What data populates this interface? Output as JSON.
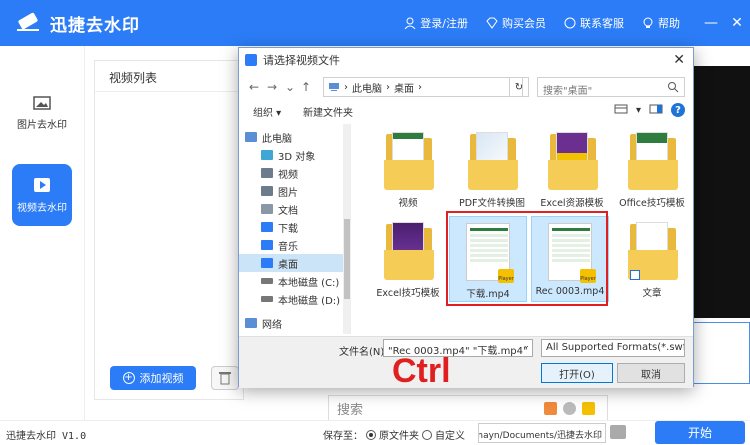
{
  "app": {
    "title": "迅捷去水印",
    "version": "迅捷去水印 V1.0",
    "header": {
      "login": "登录/注册",
      "vip": "购买会员",
      "service": "联系客服",
      "help": "帮助",
      "minimize": "—",
      "close": "✕"
    },
    "sidebar": {
      "items": [
        {
          "label": "图片去水印"
        },
        {
          "label": "视频去水印"
        }
      ]
    },
    "panel": {
      "title": "视频列表",
      "add_button": "添加视频"
    },
    "footer": {
      "save_label": "保存至：",
      "option_original": "原文件夹",
      "option_custom": "自定义",
      "path": "ers/mayn/Documents/迅捷去水印",
      "start_button": "开始"
    }
  },
  "ime": {
    "placeholder": "搜索"
  },
  "dialog": {
    "title": "请选择视频文件",
    "close": "✕",
    "nav": {
      "back": "←",
      "forward": "→",
      "dropdown": "⌄",
      "up": "↑"
    },
    "address": [
      "此电脑",
      "桌面"
    ],
    "search_placeholder": "搜索\"桌面\"",
    "toolbar": {
      "organize": "组织 ▾",
      "new_folder": "新建文件夹"
    },
    "nav_pane": [
      {
        "label": "此电脑",
        "color": "#5a8fd6"
      },
      {
        "label": "3D 对象",
        "color": "#3fa7d6"
      },
      {
        "label": "视频",
        "color": "#6d7c8c"
      },
      {
        "label": "图片",
        "color": "#6d7c8c"
      },
      {
        "label": "文档",
        "color": "#8a97a6"
      },
      {
        "label": "下载",
        "color": "#2b7cf6"
      },
      {
        "label": "音乐",
        "color": "#2b7cf6"
      },
      {
        "label": "桌面",
        "color": "#2b7cf6"
      },
      {
        "label": "本地磁盘 (C:)",
        "color": "#777"
      },
      {
        "label": "本地磁盘 (D:)",
        "color": "#777"
      },
      {
        "label": "网络",
        "color": "#5a8fd6"
      }
    ],
    "files": [
      {
        "name": "视频",
        "kind": "folder"
      },
      {
        "name": "PDF文件转换图",
        "kind": "folder"
      },
      {
        "name": "Excel资源模板",
        "kind": "folder"
      },
      {
        "name": "Office技巧模板",
        "kind": "folder"
      },
      {
        "name": "Excel技巧模板",
        "kind": "folder"
      },
      {
        "name": "下载.mp4",
        "kind": "video"
      },
      {
        "name": "Rec 0003.mp4",
        "kind": "video"
      },
      {
        "name": "文章",
        "kind": "folder"
      }
    ],
    "filename_label": "文件名(N):",
    "filename_value": "\"Rec 0003.mp4\" \"下载.mp4\"",
    "format": "All Supported Formats(*.swf;",
    "open_button": "打开(O)",
    "cancel_button": "取消"
  },
  "overlay": {
    "ctrl_text": "Ctrl"
  },
  "colors": {
    "accent": "#2b7cf6",
    "highlight": "#e02020"
  }
}
